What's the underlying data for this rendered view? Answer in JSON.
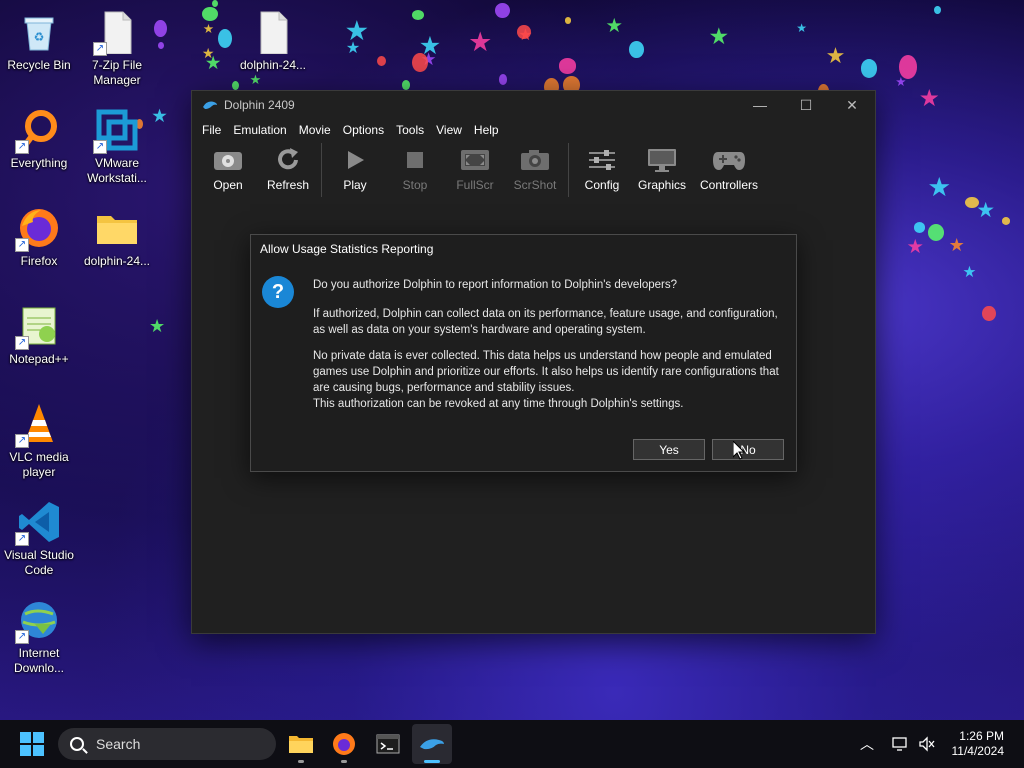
{
  "desktop": {
    "icons": [
      {
        "label": "Recycle Bin"
      },
      {
        "label": "7-Zip File Manager"
      },
      {
        "label": "dolphin-24..."
      },
      {
        "label": "Everything"
      },
      {
        "label": "VMware Workstati..."
      },
      {
        "label": "Firefox"
      },
      {
        "label": "dolphin-24..."
      },
      {
        "label": "Notepad++"
      },
      {
        "label": "VLC media player"
      },
      {
        "label": "Visual Studio Code"
      },
      {
        "label": "Internet Downlo..."
      }
    ]
  },
  "window": {
    "title": "Dolphin 2409",
    "menu": [
      "File",
      "Emulation",
      "Movie",
      "Options",
      "Tools",
      "View",
      "Help"
    ],
    "toolbar": [
      {
        "label": "Open",
        "icon": "open-icon",
        "enabled": true
      },
      {
        "label": "Refresh",
        "icon": "refresh-icon",
        "enabled": true
      },
      {
        "label": "Play",
        "icon": "play-icon",
        "enabled": true
      },
      {
        "label": "Stop",
        "icon": "stop-icon",
        "enabled": false
      },
      {
        "label": "FullScr",
        "icon": "fullscreen-icon",
        "enabled": false
      },
      {
        "label": "ScrShot",
        "icon": "screenshot-icon",
        "enabled": false
      },
      {
        "label": "Config",
        "icon": "config-icon",
        "enabled": true
      },
      {
        "label": "Graphics",
        "icon": "graphics-icon",
        "enabled": true
      },
      {
        "label": "Controllers",
        "icon": "controllers-icon",
        "enabled": true
      }
    ]
  },
  "dialog": {
    "title": "Allow Usage Statistics Reporting",
    "question": "Do you authorize Dolphin to report information to Dolphin's developers?",
    "para1": "If authorized, Dolphin can collect data on its performance, feature usage, and configuration, as well as data on your system's hardware and operating system.",
    "para2": "No private data is ever collected. This data helps us understand how people and emulated games use Dolphin and prioritize our efforts. It also helps us identify rare configurations that are causing bugs, performance and stability issues.",
    "para3": "This authorization can be revoked at any time through Dolphin's settings.",
    "yes_label": "Yes",
    "no_label": "No"
  },
  "taskbar": {
    "search_placeholder": "Search",
    "time": "1:26 PM",
    "date": "11/4/2024"
  },
  "colors": {
    "accent": "#4cc2ff",
    "dolphin_blue": "#3ba0e6",
    "window_bg": "#202020"
  }
}
